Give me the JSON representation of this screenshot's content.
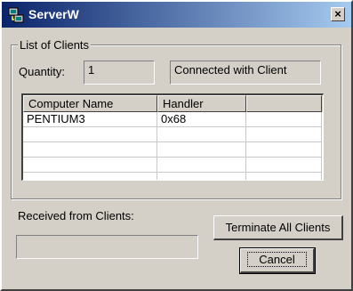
{
  "window": {
    "title": "ServerW",
    "close_label": "×",
    "titlebar_color_start": "#0a246a",
    "titlebar_color_end": "#a6caf0",
    "face_color": "#d4d0c8"
  },
  "clients_group": {
    "label": "List of Clients",
    "quantity_label": "Quantity:",
    "quantity_value": "1",
    "status_text": "Connected with Client"
  },
  "clients_list": {
    "columns": [
      "Computer Name",
      "Handler",
      ""
    ],
    "rows": [
      [
        "PENTIUM3",
        "0x68",
        ""
      ],
      [
        "",
        "",
        ""
      ],
      [
        "",
        "",
        ""
      ],
      [
        "",
        "",
        ""
      ],
      [
        "",
        "",
        ""
      ]
    ]
  },
  "received": {
    "label": "Received from Clients:",
    "value": ""
  },
  "buttons": {
    "terminate_label": "Terminate All Clients",
    "cancel_label": "Cancel"
  }
}
